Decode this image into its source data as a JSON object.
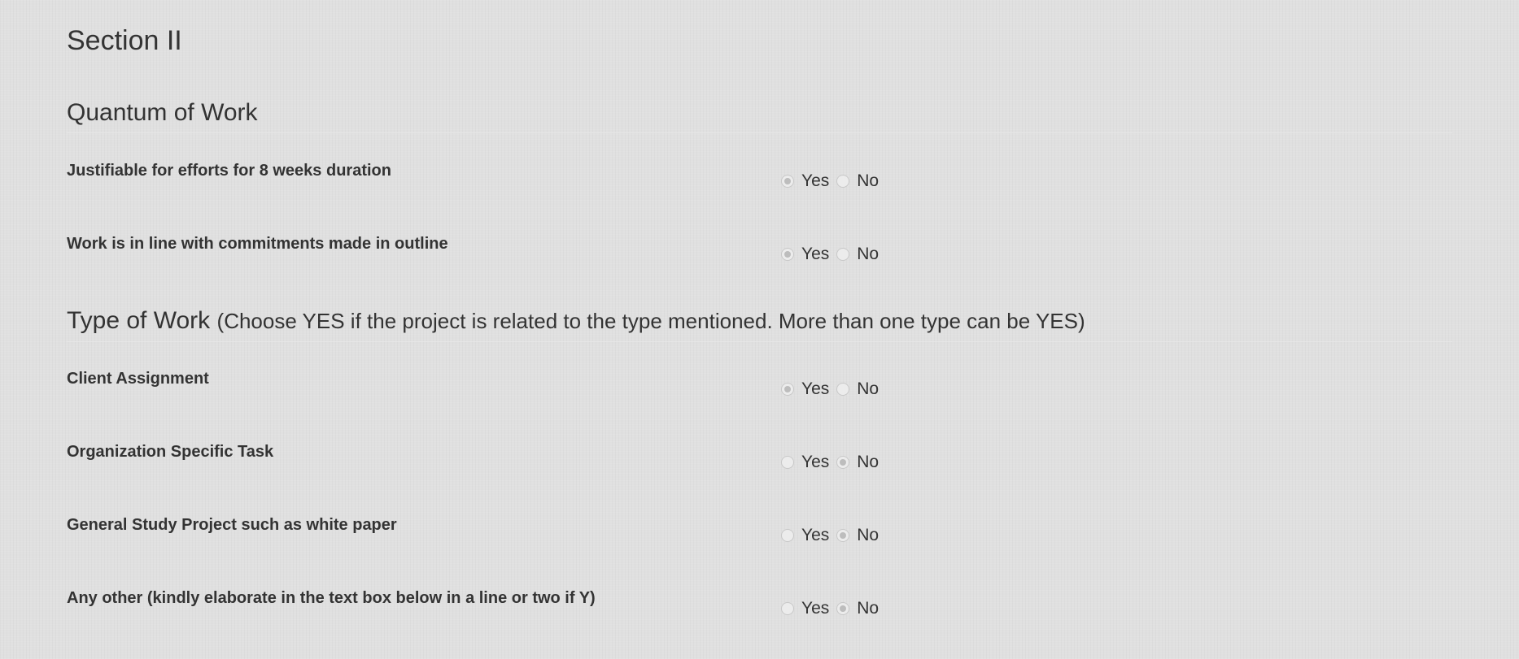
{
  "section": {
    "title": "Section II"
  },
  "quantum": {
    "title": "Quantum of Work",
    "questions": [
      {
        "label": "Justifiable for efforts for 8 weeks duration",
        "yes": "Yes",
        "no": "No",
        "selected": "Yes"
      },
      {
        "label": "Work is in line with commitments made in outline",
        "yes": "Yes",
        "no": "No",
        "selected": "Yes"
      }
    ]
  },
  "type_of_work": {
    "title": "Type of Work",
    "note": "(Choose YES if the project is related to the type mentioned. More than one type can be YES)",
    "questions": [
      {
        "label": "Client Assignment",
        "yes": "Yes",
        "no": "No",
        "selected": "Yes"
      },
      {
        "label": "Organization Specific Task",
        "yes": "Yes",
        "no": "No",
        "selected": "No"
      },
      {
        "label": "General Study Project such as white paper",
        "yes": "Yes",
        "no": "No",
        "selected": "No"
      },
      {
        "label": "Any other (kindly elaborate in the text box below in a line or two if Y)",
        "yes": "Yes",
        "no": "No",
        "selected": "No"
      }
    ]
  }
}
